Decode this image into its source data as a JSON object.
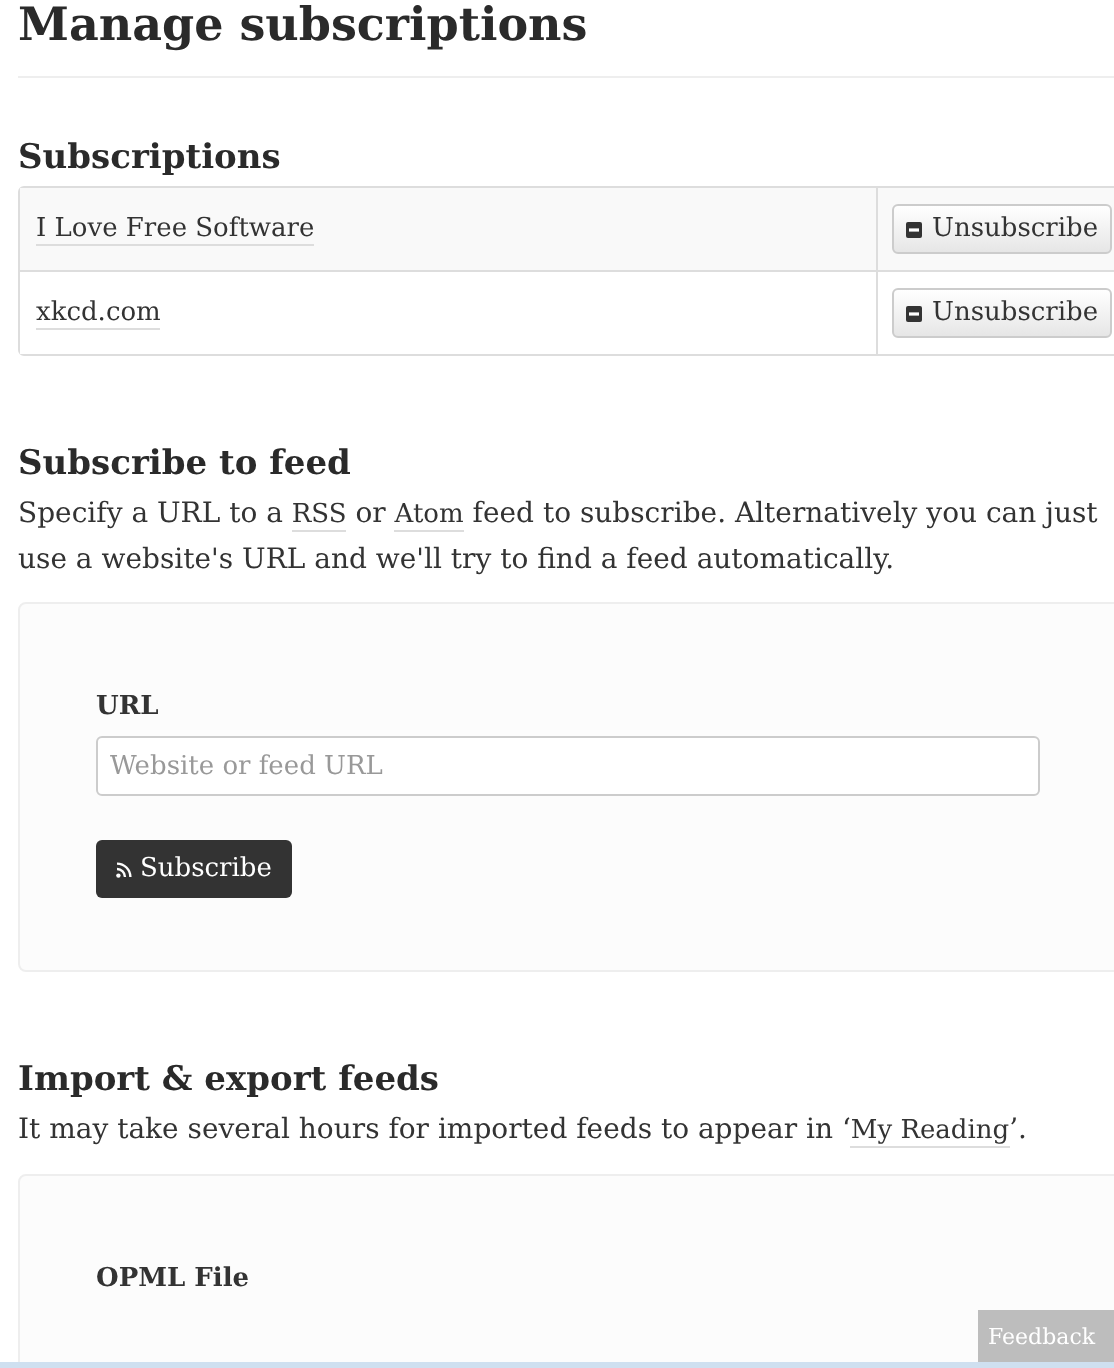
{
  "title": "Manage subscriptions",
  "subscriptions": {
    "heading": "Subscriptions",
    "rows": [
      {
        "name": "I Love Free Software",
        "action": "Unsubscribe"
      },
      {
        "name": "xkcd.com",
        "action": "Unsubscribe"
      }
    ]
  },
  "subscribe": {
    "heading": "Subscribe to feed",
    "description": [
      {
        "kind": "text",
        "text": "Specify a URL to a "
      },
      {
        "kind": "link",
        "text": "RSS"
      },
      {
        "kind": "text",
        "text": " or "
      },
      {
        "kind": "link",
        "text": "Atom"
      },
      {
        "kind": "text",
        "text": " feed to subscribe. Alternatively you can just use a website's URL and we'll try to find a feed automatically."
      }
    ],
    "field_label": "URL",
    "placeholder": "Website or feed URL",
    "button": "Subscribe"
  },
  "import_export": {
    "heading": "Import & export feeds",
    "description": [
      {
        "kind": "text",
        "text": "It may take several hours for imported feeds to appear in ‘"
      },
      {
        "kind": "link",
        "text": "My Reading"
      },
      {
        "kind": "text",
        "text": "’."
      }
    ],
    "field_label": "OPML File"
  },
  "feedback": "Feedback"
}
